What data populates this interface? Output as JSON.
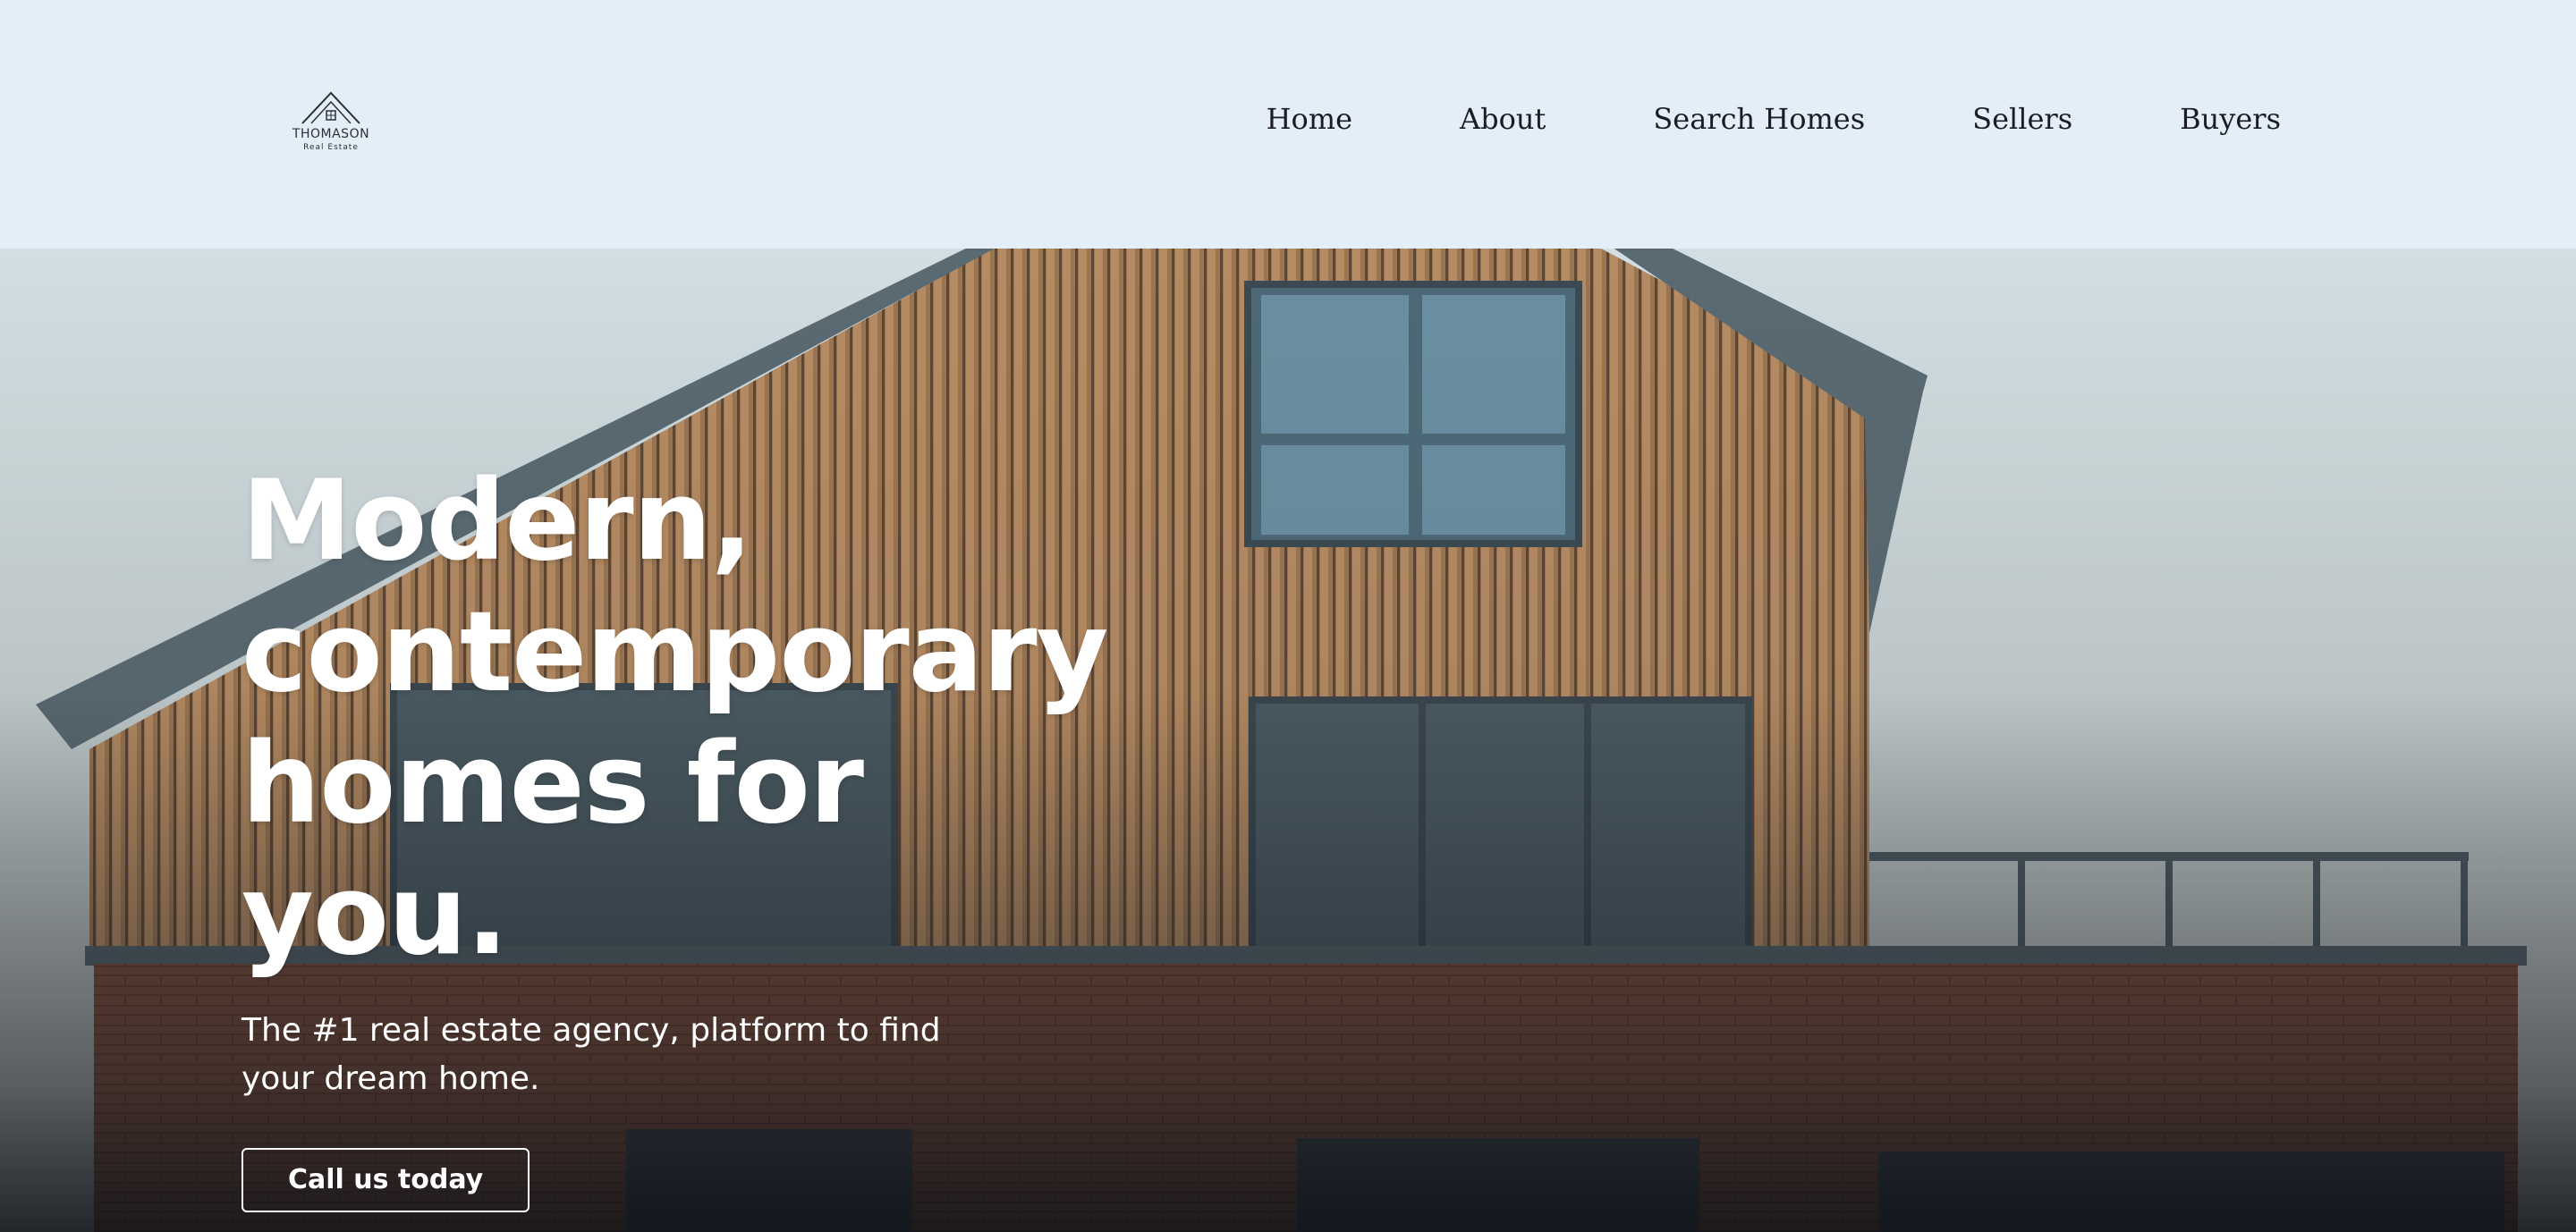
{
  "brand": {
    "name": "THOMASON",
    "tagline": "Real Estate"
  },
  "nav": {
    "items": [
      {
        "label": "Home"
      },
      {
        "label": "About"
      },
      {
        "label": "Search Homes"
      },
      {
        "label": "Sellers"
      },
      {
        "label": "Buyers"
      }
    ]
  },
  "hero": {
    "title": "Modern,\ncontemporary\nhomes for you.",
    "subtitle": "The #1 real estate agency, platform to find your dream home.",
    "cta_label": "Call us today",
    "image_icon": "modern-house-photo"
  },
  "colors": {
    "header_bg": "#e3eef9",
    "nav_text": "#1a1d24",
    "hero_text": "#ffffff"
  }
}
